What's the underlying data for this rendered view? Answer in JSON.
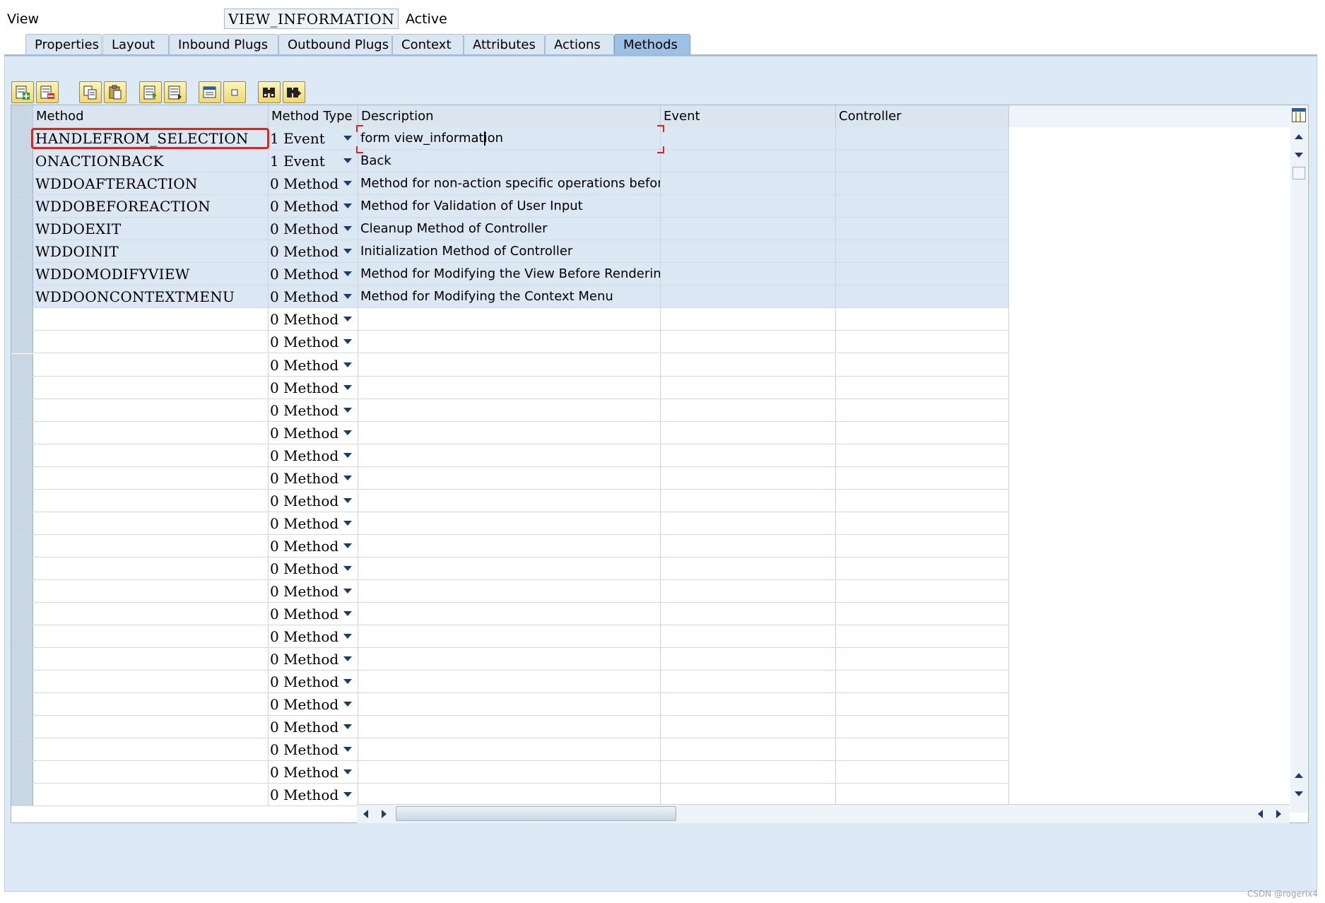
{
  "header": {
    "view_label": "View",
    "view_name": "VIEW_INFORMATION",
    "status": "Active"
  },
  "tabs": [
    {
      "label": "Properties",
      "active": false
    },
    {
      "label": "Layout",
      "active": false
    },
    {
      "label": "Inbound Plugs",
      "active": false
    },
    {
      "label": "Outbound Plugs",
      "active": false
    },
    {
      "label": "Context",
      "active": false
    },
    {
      "label": "Attributes",
      "active": false
    },
    {
      "label": "Actions",
      "active": false
    },
    {
      "label": "Methods",
      "active": true
    }
  ],
  "toolbar": {
    "buttons": [
      "append-row-icon",
      "delete-row-icon",
      "copy-icon",
      "paste-icon",
      "insert-row-icon",
      "details-icon",
      "select-all-icon",
      "deselect-icon",
      "find-icon",
      "find-next-icon"
    ]
  },
  "table": {
    "columns": [
      "Method",
      "Method Type",
      "Description",
      "Event",
      "Controller"
    ],
    "rows": [
      {
        "method": "HANDLEFROM_SELECTION",
        "type": "1 Event",
        "description": "form view_information",
        "event": "",
        "controller": ""
      },
      {
        "method": "ONACTIONBACK",
        "type": "1 Event",
        "description": "Back",
        "event": "",
        "controller": ""
      },
      {
        "method": "WDDOAFTERACTION",
        "type": "0 Method",
        "description": "Method for non-action specific operations before nav",
        "event": "",
        "controller": ""
      },
      {
        "method": "WDDOBEFOREACTION",
        "type": "0 Method",
        "description": "Method for Validation of User Input",
        "event": "",
        "controller": ""
      },
      {
        "method": "WDDOEXIT",
        "type": "0 Method",
        "description": "Cleanup Method of Controller",
        "event": "",
        "controller": ""
      },
      {
        "method": "WDDOINIT",
        "type": "0 Method",
        "description": "Initialization Method of Controller",
        "event": "",
        "controller": ""
      },
      {
        "method": "WDDOMODIFYVIEW",
        "type": "0 Method",
        "description": "Method for Modifying the View Before Rendering",
        "event": "",
        "controller": ""
      },
      {
        "method": "WDDOONCONTEXTMENU",
        "type": "0 Method",
        "description": "Method for Modifying the Context Menu",
        "event": "",
        "controller": ""
      }
    ],
    "empty_row_type": "0 Method",
    "empty_row_count": 22
  },
  "watermark": "CSDN @rogerix4"
}
